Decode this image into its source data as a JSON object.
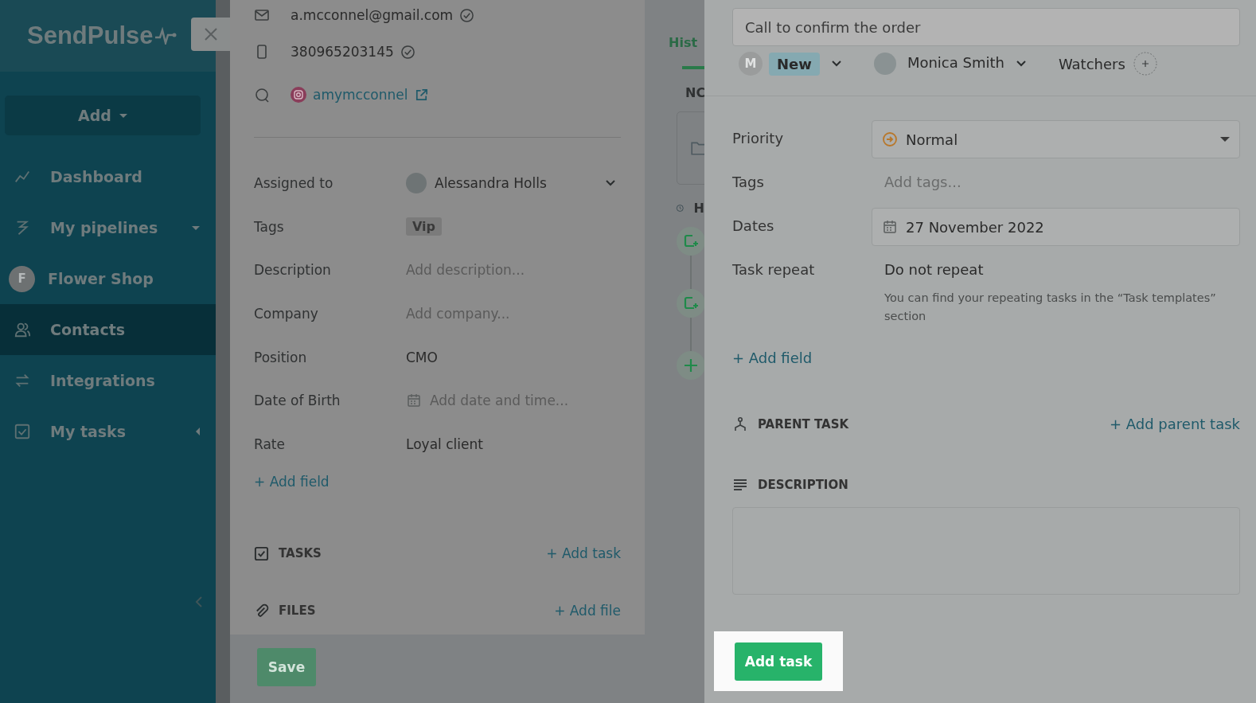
{
  "sidebar": {
    "logo": "SendPulse",
    "add_button": "Add",
    "items": [
      {
        "kind": "link",
        "label": "Dashboard",
        "selected": false
      },
      {
        "kind": "group",
        "label": "My pipelines",
        "selected": false,
        "expanded": true
      },
      {
        "kind": "project",
        "avatar": "F",
        "label": "Flower Shop",
        "selected": false
      },
      {
        "kind": "link",
        "label": "Contacts",
        "selected": true
      },
      {
        "kind": "link",
        "label": "Integrations",
        "selected": false
      },
      {
        "kind": "group",
        "label": "My tasks",
        "selected": false,
        "expanded": false
      }
    ]
  },
  "contact": {
    "email": "a.mcconnel@gmail.com",
    "phone": "380965203145",
    "instagram": "amymcconnel",
    "fields": [
      {
        "kind": "user",
        "label": "Assigned to",
        "value": "Alessandra Holls"
      },
      {
        "kind": "tag",
        "label": "Tags",
        "value": "Vip"
      },
      {
        "kind": "placeholder",
        "label": "Description",
        "value": "Add description..."
      },
      {
        "kind": "placeholder",
        "label": "Company",
        "value": "Add company..."
      },
      {
        "kind": "text",
        "label": "Position",
        "value": "CMO"
      },
      {
        "kind": "date",
        "label": "Date of Birth",
        "value": "Add date and time..."
      },
      {
        "kind": "text",
        "label": "Rate",
        "value": "Loyal client"
      }
    ],
    "add_field": "+ Add field",
    "sections": [
      {
        "kind": "tasks",
        "title": "TASKS",
        "action": "+ Add task"
      },
      {
        "kind": "files",
        "title": "FILES",
        "action": "+ Add file"
      }
    ],
    "save_button": "Save"
  },
  "history": {
    "tab": "Hist",
    "notes": "NC",
    "heading": "H"
  },
  "task": {
    "title": "Call to confirm the order",
    "creator_initial": "M",
    "status": "New",
    "assignee": "Monica Smith",
    "watchers": "Watchers",
    "fields": [
      {
        "kind": "select",
        "label": "Priority",
        "value": "Normal"
      },
      {
        "kind": "placeholder",
        "label": "Tags",
        "value": "Add tags..."
      },
      {
        "kind": "date",
        "label": "Dates",
        "value": "27 November 2022"
      },
      {
        "kind": "text",
        "label": "Task repeat",
        "value": "Do not repeat",
        "hint": "You can find your repeating tasks in the “Task templates” section"
      }
    ],
    "add_field": "+ Add field",
    "parent_task": {
      "title": "PARENT TASK",
      "action": "+ Add parent task"
    },
    "description": {
      "title": "DESCRIPTION"
    },
    "submit_button": "Add task"
  }
}
